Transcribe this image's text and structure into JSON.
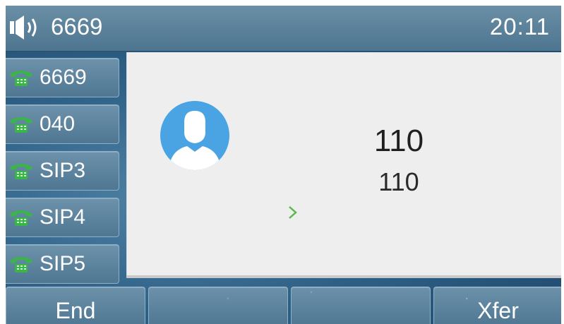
{
  "status": {
    "line_number": "6669",
    "time": "20:11"
  },
  "line_keys": [
    {
      "label": "6669",
      "icon": "phone-icon"
    },
    {
      "label": "040",
      "icon": "phone-icon"
    },
    {
      "label": "SIP3",
      "icon": "phone-icon"
    },
    {
      "label": "SIP4",
      "icon": "phone-icon"
    },
    {
      "label": "SIP5",
      "icon": "phone-icon"
    }
  ],
  "call": {
    "name": "110",
    "number": "110",
    "avatar_color": "#4aa3e2",
    "indicator_color": "#5cb84a"
  },
  "softkeys": [
    "End",
    "",
    "",
    "Xfer"
  ],
  "colors": {
    "phone_icon": "#3bb44a",
    "panel_bg": "#eeeeee"
  }
}
